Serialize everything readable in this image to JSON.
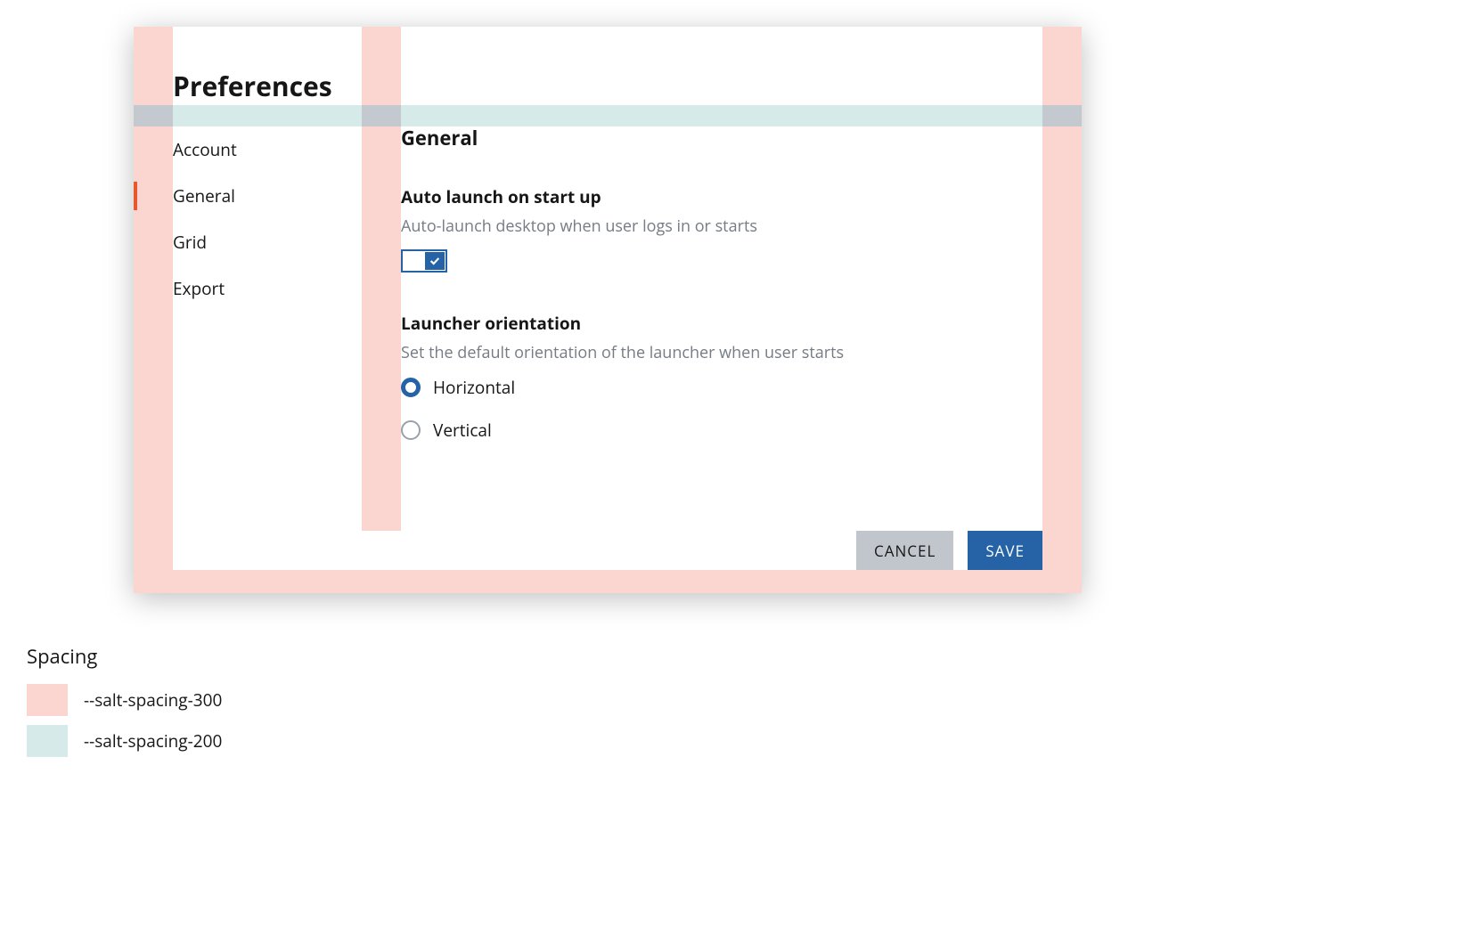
{
  "page": {
    "title": "Preferences"
  },
  "sidebar": {
    "items": [
      {
        "label": "Account",
        "active": false
      },
      {
        "label": "General",
        "active": true
      },
      {
        "label": "Grid",
        "active": false
      },
      {
        "label": "Export",
        "active": false
      }
    ]
  },
  "content": {
    "section_heading": "General",
    "auto_launch": {
      "label": "Auto launch on start up",
      "help": "Auto-launch desktop when user logs in or starts",
      "value": true
    },
    "orientation": {
      "label": "Launcher orientation",
      "help": "Set the default orientation of the launcher when user starts",
      "options": [
        {
          "label": "Horizontal",
          "selected": true
        },
        {
          "label": "Vertical",
          "selected": false
        }
      ]
    }
  },
  "footer": {
    "cancel_label": "CANCEL",
    "save_label": "SAVE"
  },
  "legend": {
    "title": "Spacing",
    "items": [
      {
        "token": "--salt-spacing-300",
        "color": "#fbd5d0"
      },
      {
        "token": "--salt-spacing-200",
        "color": "#d5eae9"
      }
    ]
  },
  "colors": {
    "accent": "#2563a6",
    "nav_active_indicator": "#e9582b",
    "spacing_300": "#fbd5d0",
    "spacing_200": "#d5eae9",
    "text_muted": "#757c85",
    "button_secondary_bg": "#c1c5cc"
  }
}
